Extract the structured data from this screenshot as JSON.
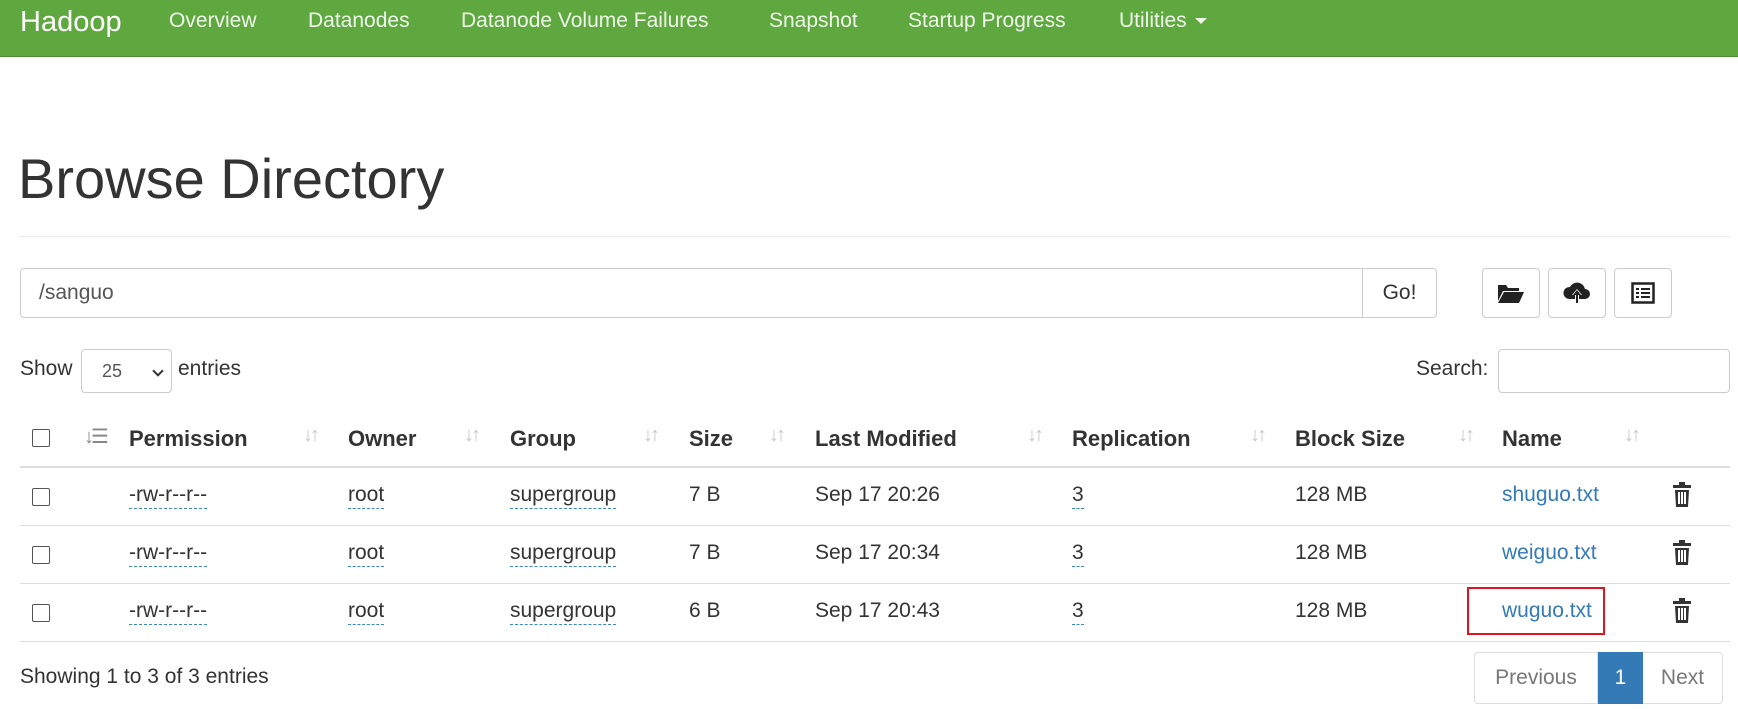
{
  "navbar": {
    "brand": "Hadoop",
    "items": [
      "Overview",
      "Datanodes",
      "Datanode Volume Failures",
      "Snapshot",
      "Startup Progress",
      "Utilities"
    ],
    "background": "#5fa73f"
  },
  "page": {
    "title": "Browse Directory"
  },
  "pathbar": {
    "path": "/sanguo",
    "go_label": "Go!",
    "tools": [
      "folder-open-icon",
      "cloud-upload-icon",
      "list-alt-icon"
    ]
  },
  "table_controls": {
    "show_label": "Show",
    "page_length": "25",
    "entries_label": "entries",
    "search_label": "Search:",
    "search_value": ""
  },
  "table": {
    "columns": [
      "Permission",
      "Owner",
      "Group",
      "Size",
      "Last Modified",
      "Replication",
      "Block Size",
      "Name"
    ],
    "rows": [
      {
        "permission": "-rw-r--r--",
        "owner": "root",
        "group": "supergroup",
        "size": "7 B",
        "modified": "Sep 17 20:26",
        "replication": "3",
        "block_size": "128 MB",
        "name": "shuguo.txt"
      },
      {
        "permission": "-rw-r--r--",
        "owner": "root",
        "group": "supergroup",
        "size": "7 B",
        "modified": "Sep 17 20:34",
        "replication": "3",
        "block_size": "128 MB",
        "name": "weiguo.txt"
      },
      {
        "permission": "-rw-r--r--",
        "owner": "root",
        "group": "supergroup",
        "size": "6 B",
        "modified": "Sep 17 20:43",
        "replication": "3",
        "block_size": "128 MB",
        "name": "wuguo.txt"
      }
    ],
    "highlight_color": "#e0141e",
    "link_color": "#337ab7"
  },
  "footer": {
    "info": "Showing 1 to 3 of 3 entries",
    "previous": "Previous",
    "current_page": "1",
    "next": "Next",
    "accent": "#337ab7"
  }
}
